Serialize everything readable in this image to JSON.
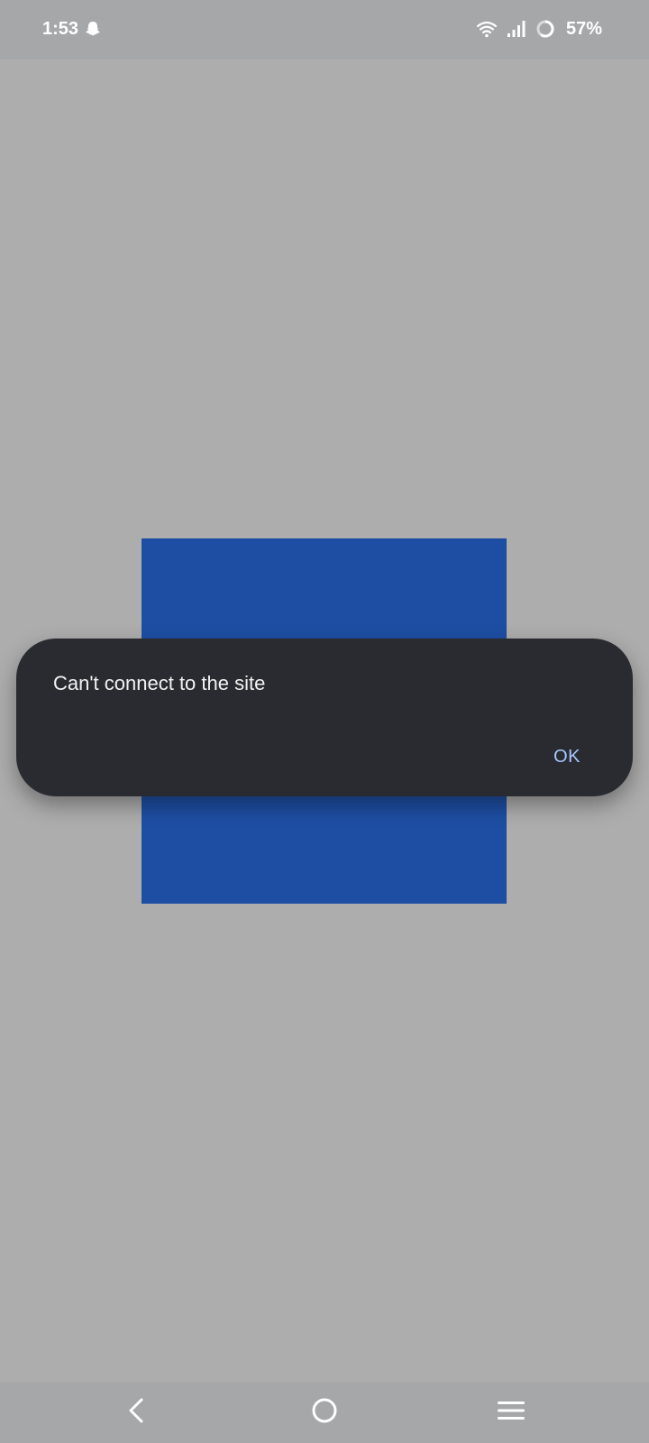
{
  "status_bar": {
    "time": "1:53",
    "battery": "57%",
    "icons": [
      "snapchat-ghost-icon",
      "wifi-icon",
      "signal-icon",
      "battery-ring-icon"
    ]
  },
  "dialog": {
    "message": "Can't connect to the site",
    "ok_label": "OK"
  },
  "colors": {
    "background": "#adadad",
    "status_bar": "#a6a7a9",
    "blue_square": "#1e4ea3",
    "dialog_bg": "#2a2b30",
    "dialog_text": "#f2f2f2",
    "ok_accent": "#a9c7ff"
  },
  "nav_bar": {
    "icons": [
      "back-icon",
      "home-icon",
      "recents-menu-icon"
    ]
  }
}
